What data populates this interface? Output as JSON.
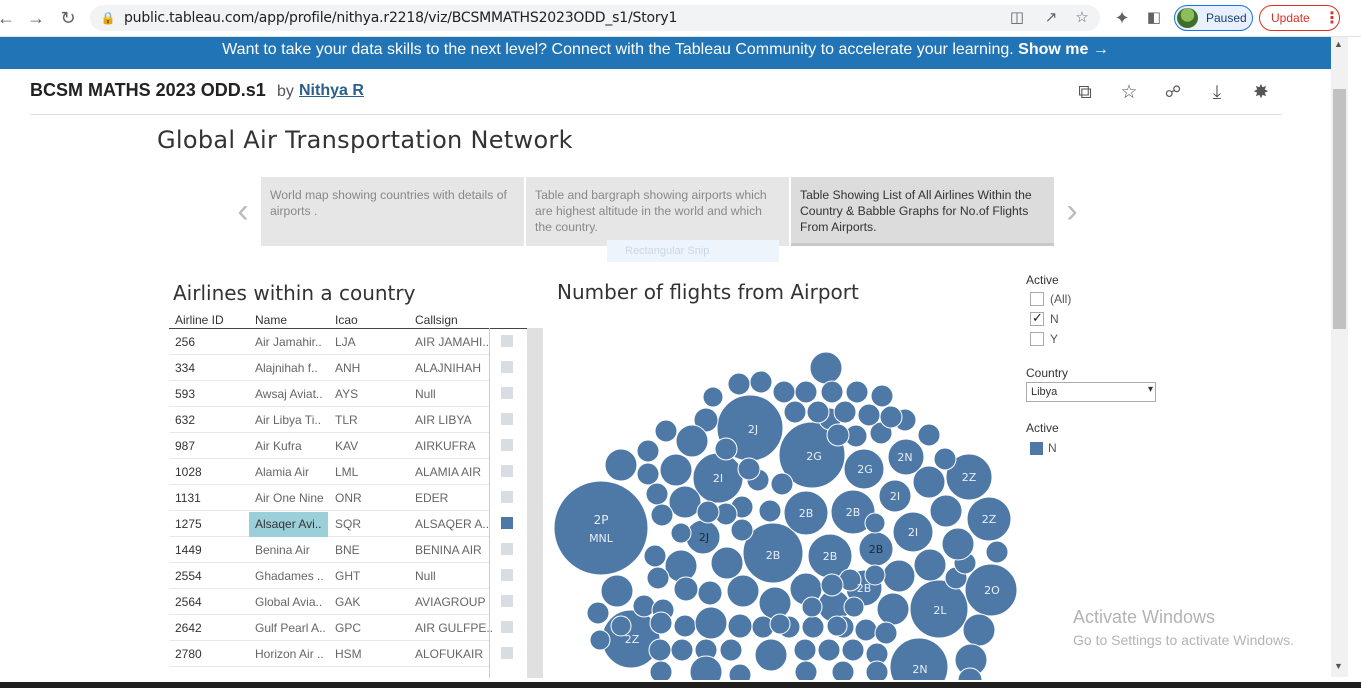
{
  "browser": {
    "url": "public.tableau.com/app/profile/nithya.r2218/viz/BCSMMATHS2023ODD_s1/Story1",
    "profile_status": "Paused",
    "update_label": "Update",
    "icons": [
      "back-icon",
      "forward-icon",
      "reload-icon",
      "lock-icon",
      "translate-icon",
      "share-icon",
      "bookmark-star-icon",
      "extensions-icon",
      "side-panel-icon",
      "menu-icon"
    ]
  },
  "banner": {
    "text": "Want to take your data skills to the next level? Connect with the Tableau Community to accelerate your learning.",
    "link": "Show me →",
    "color": "#2174b6"
  },
  "viz": {
    "title": "BCSM MATHS 2023 ODD.s1",
    "by": "by",
    "author": "Nithya R",
    "tool_icons": [
      "copy-icon",
      "favorite-star-icon",
      "share-icon",
      "download-icon",
      "badge-icon"
    ]
  },
  "story": {
    "title": "Global Air Transportation Network",
    "points": [
      "World map showing countries with details of airports .",
      "Table and bargraph showing airports which are  highest altitude in the world and which the country.",
      "Table Showing List of All Airlines Within the Country & Babble Graphs for No.of Flights From Airports."
    ],
    "active_point": 2,
    "snip_overlay": "Rectangular Snip"
  },
  "airlines_table": {
    "title": "Airlines within a country",
    "columns": [
      "Airline ID",
      "Name",
      "Icao",
      "Callsign"
    ],
    "rows": [
      {
        "id": "256",
        "name": "Air Jamahir..",
        "icao": "LJA",
        "callsign": "AIR JAMAHI.."
      },
      {
        "id": "334",
        "name": "Alajnihah f..",
        "icao": "ANH",
        "callsign": "ALAJNIHAH"
      },
      {
        "id": "593",
        "name": "Awsaj Aviat..",
        "icao": "AYS",
        "callsign": "Null"
      },
      {
        "id": "632",
        "name": "Air Libya Ti..",
        "icao": "TLR",
        "callsign": "AIR LIBYA"
      },
      {
        "id": "987",
        "name": "Air Kufra",
        "icao": "KAV",
        "callsign": "AIRKUFRA"
      },
      {
        "id": "1028",
        "name": "Alamia Air",
        "icao": "LML",
        "callsign": "ALAMIA AIR"
      },
      {
        "id": "1131",
        "name": "Air One Nine",
        "icao": "ONR",
        "callsign": "EDER"
      },
      {
        "id": "1275",
        "name": "Alsaqer Avi..",
        "icao": "SQR",
        "callsign": "ALSAQER A..",
        "selected": true
      },
      {
        "id": "1449",
        "name": "Benina Air",
        "icao": "BNE",
        "callsign": "BENINA AIR"
      },
      {
        "id": "2554",
        "name": "Ghadames ..",
        "icao": "GHT",
        "callsign": "Null"
      },
      {
        "id": "2564",
        "name": "Global Avia..",
        "icao": "GAK",
        "callsign": "AVIAGROUP"
      },
      {
        "id": "2642",
        "name": "Gulf Pearl A..",
        "icao": "GPC",
        "callsign": "AIR GULFPE.."
      },
      {
        "id": "2780",
        "name": "Horizon Air ..",
        "icao": "HSM",
        "callsign": "ALOFUKAIR"
      }
    ]
  },
  "bubble_chart": {
    "title": "Number of flights from Airport",
    "color": "#4e79a7",
    "labels": [
      "2P",
      "MNL",
      "2J",
      "2G",
      "2G",
      "2N",
      "2Z",
      "2I",
      "2I",
      "2Z",
      "2B",
      "2B",
      "2I",
      "2J",
      "2B",
      "2B",
      "2B",
      "2B",
      "2O",
      "2L",
      "2Z",
      "2N"
    ]
  },
  "filters": {
    "active_label": "Active",
    "active_options": [
      {
        "label": "(All)",
        "checked": false
      },
      {
        "label": "N",
        "checked": true
      },
      {
        "label": "Y",
        "checked": false
      }
    ],
    "country_label": "Country",
    "country_value": "Libya",
    "legend_label": "Active",
    "legend_item": "N"
  },
  "watermark": {
    "line1": "Activate Windows",
    "line2": "Go to Settings to activate Windows."
  }
}
